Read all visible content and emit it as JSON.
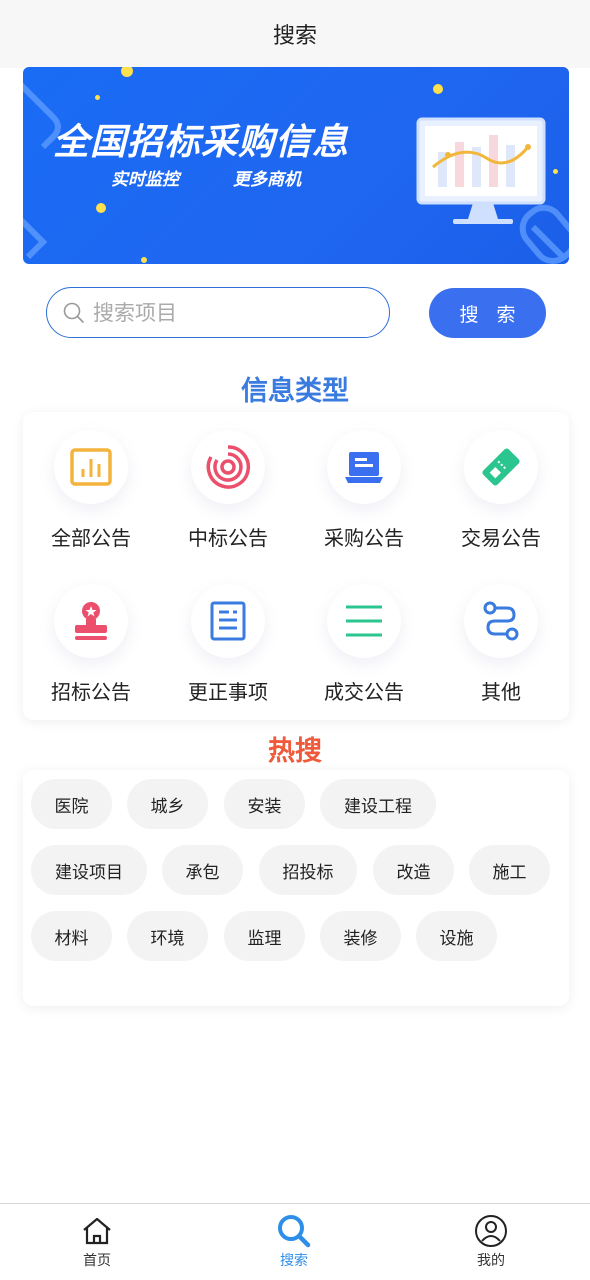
{
  "header": {
    "title": "搜索"
  },
  "banner": {
    "title": "全国招标采购信息",
    "subtitle_left": "实时监控",
    "subtitle_right": "更多商机"
  },
  "search": {
    "placeholder": "搜索项目",
    "value": "",
    "button_label": "搜 索"
  },
  "info_types": {
    "title": "信息类型",
    "title_color": "#3a7be0",
    "items": [
      {
        "label": "全部公告",
        "icon": "bar-chart-icon",
        "color": "#f3b33d"
      },
      {
        "label": "中标公告",
        "icon": "target-icon",
        "color": "#ec4f6b"
      },
      {
        "label": "采购公告",
        "icon": "laptop-icon",
        "color": "#3a6ff0"
      },
      {
        "label": "交易公告",
        "icon": "ticket-icon",
        "color": "#2bc58f"
      },
      {
        "label": "招标公告",
        "icon": "stamp-icon",
        "color": "#ec4f6b"
      },
      {
        "label": "更正事项",
        "icon": "document-icon",
        "color": "#3a7be0"
      },
      {
        "label": "成交公告",
        "icon": "list-icon",
        "color": "#2bc58f"
      },
      {
        "label": "其他",
        "icon": "route-icon",
        "color": "#3a7be0"
      }
    ]
  },
  "hot_search": {
    "title": "热搜",
    "title_color": "#ee5a3a",
    "chips": [
      "医院",
      "城乡",
      "安装",
      "建设工程",
      "建设项目",
      "承包",
      "招投标",
      "改造",
      "施工",
      "材料",
      "环境",
      "监理",
      "装修",
      "设施"
    ]
  },
  "tabbar": {
    "items": [
      {
        "label": "首页",
        "icon": "home-icon",
        "active": false
      },
      {
        "label": "搜索",
        "icon": "search-icon",
        "active": true
      },
      {
        "label": "我的",
        "icon": "user-icon",
        "active": false
      }
    ],
    "active_color": "#2f8ee8"
  }
}
